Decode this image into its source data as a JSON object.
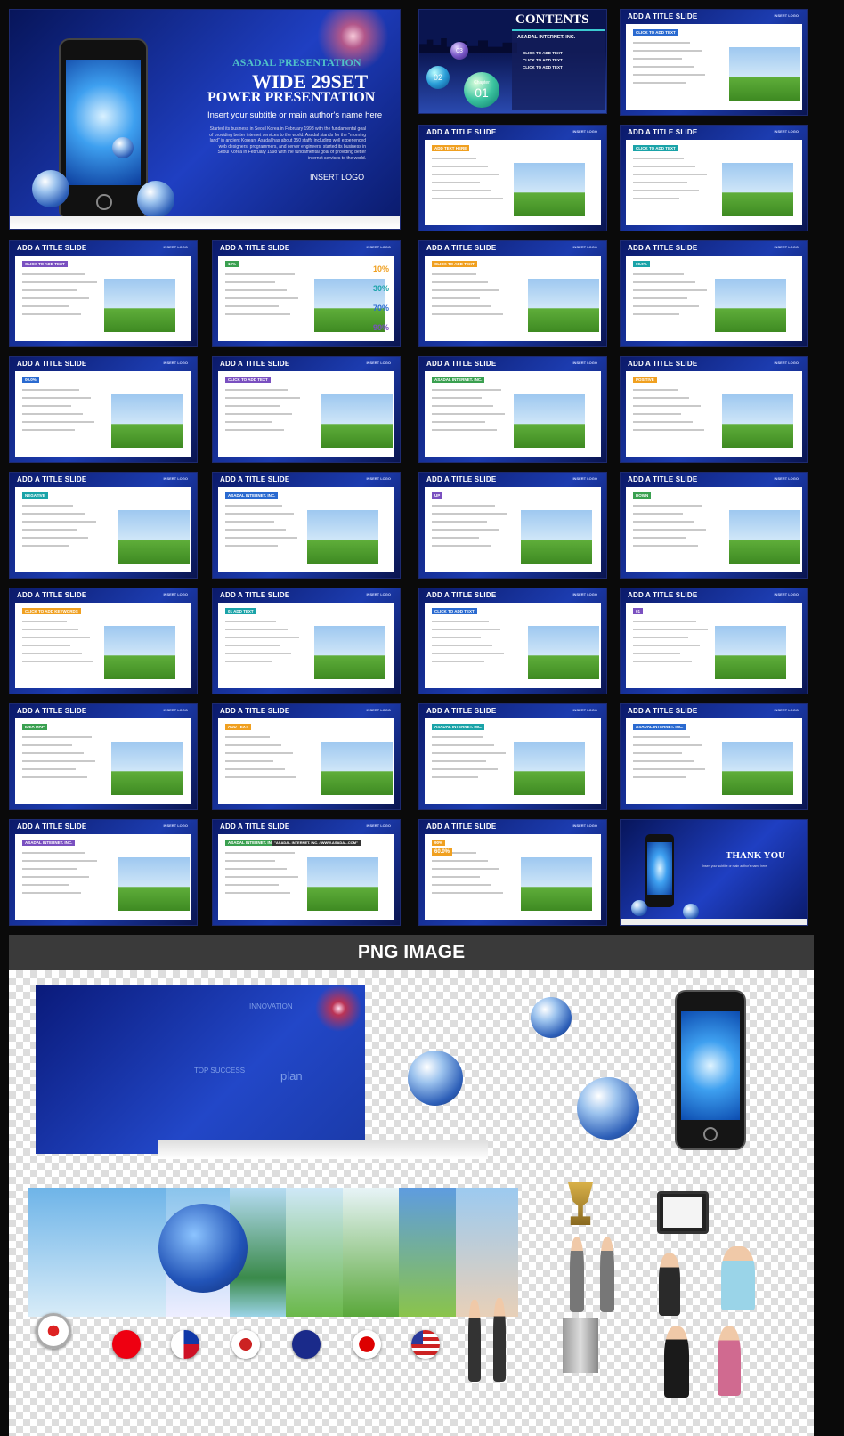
{
  "cover": {
    "kicker": "ASADAL PRESENTATION",
    "title1": "WIDE 29SET",
    "title2": "POWER PRESENTATION",
    "subtitle": "Insert your subtitle or main author's name here",
    "body": "Started its business in Seoul Korea in February 1998 with the fundamental goal of providing better internet services to the world. Asadal stands for the \"morning land\" in ancient Korean. Asadal has about 350 staffs including well experienced web designers, programmers, and server engineers. started its business in Seoul Korea in February 1998 with the fundamental goal of providing better internet services to the world.",
    "logo": "INSERT LOGO"
  },
  "contents": {
    "title": "CONTENTS",
    "company": "ASADAL INTERNET. INC.",
    "items": [
      "CLICK TO ADD TEXT",
      "CLICK TO ADD TEXT",
      "CLICK TO ADD TEXT"
    ],
    "chapters": [
      "03",
      "02",
      "01"
    ],
    "chapter_label": "Chapter"
  },
  "slide_title": "ADD A TITLE SLIDE",
  "insert_logo": "INSERT LOGO",
  "slide_labels": [
    "ADD TEXT HERE",
    "CLICK TO ADD TEXT",
    "CLICK TO ADD TEXT",
    "CLICK TO ADD TEXT",
    "10%",
    "CLICK TO ADD TEXT",
    "00.0%",
    "00.0%",
    "CLICK TO ADD TEXT",
    "ASADAL INTERNET. INC.",
    "POSITIVE",
    "NEGATIVE",
    "ASADAL INTERNET. INC.",
    "UP",
    "DOWN",
    "CLICK TO ADD KEYWORDS",
    "01 ADD TEXT",
    "CLICK TO ADD TEXT",
    "01",
    "IDEA MAP",
    "ADD TEXT",
    "ASADAL INTERNET. INC.",
    "ASADAL INTERNET. INC.",
    "ASADAL INTERNET. INC.",
    "ASADAL INTERNET. INC.",
    "90%",
    "CLICK TO ADD TEXT",
    "\"ASADAL INTERNET. INC. / WWW.ASADAL.COM\"",
    "ASADAL INTERNET. INC.",
    "60.0%"
  ],
  "percentages": [
    "10%",
    "30%",
    "70%",
    "90%"
  ],
  "thankyou": {
    "title": "THANK YOU",
    "subtitle": "Insert your subtitle or main author's name here"
  },
  "png_section": {
    "title": "PNG IMAGE",
    "bg_words": [
      "INNOVATION",
      "TOP SUCCESS",
      "plan"
    ]
  },
  "colors": {
    "slide_blue": "#1c3cb0",
    "accent_orange": "#f0a020",
    "teal": "#1aa3a8"
  }
}
